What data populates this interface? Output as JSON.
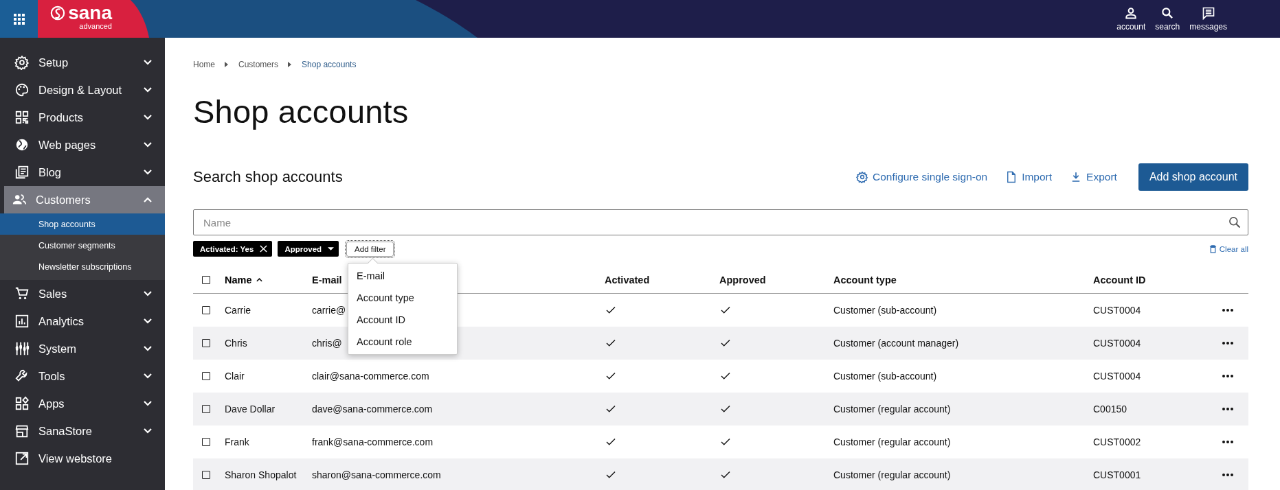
{
  "header": {
    "logo": {
      "name": "sana",
      "edition": "advanced"
    },
    "nav": [
      {
        "label": "account"
      },
      {
        "label": "search"
      },
      {
        "label": "messages"
      }
    ]
  },
  "sidebar": {
    "items": [
      {
        "label": "Setup",
        "kind": "section",
        "expanded": false
      },
      {
        "label": "Design & Layout",
        "kind": "section",
        "expanded": false
      },
      {
        "label": "Products",
        "kind": "section",
        "expanded": false
      },
      {
        "label": "Web pages",
        "kind": "section",
        "expanded": false
      },
      {
        "label": "Blog",
        "kind": "section",
        "expanded": false
      },
      {
        "label": "Customers",
        "kind": "section",
        "expanded": true,
        "children": [
          {
            "label": "Shop accounts",
            "selected": true
          },
          {
            "label": "Customer segments",
            "selected": false
          },
          {
            "label": "Newsletter subscriptions",
            "selected": false
          }
        ]
      },
      {
        "label": "Sales",
        "kind": "section",
        "expanded": false
      },
      {
        "label": "Analytics",
        "kind": "section",
        "expanded": false
      },
      {
        "label": "System",
        "kind": "section",
        "expanded": false
      },
      {
        "label": "Tools",
        "kind": "section",
        "expanded": false
      },
      {
        "label": "Apps",
        "kind": "section",
        "expanded": false
      },
      {
        "label": "SanaStore",
        "kind": "section",
        "expanded": false
      },
      {
        "label": "View webstore",
        "kind": "link"
      }
    ]
  },
  "breadcrumb": [
    "Home",
    "Customers",
    "Shop accounts"
  ],
  "page_title": "Shop accounts",
  "search_section": {
    "title": "Search shop accounts",
    "actions": [
      {
        "label": "Configure single sign-on",
        "kind": "link"
      },
      {
        "label": "Import",
        "kind": "link"
      },
      {
        "label": "Export",
        "kind": "link"
      },
      {
        "label": "Add shop account",
        "kind": "primary"
      }
    ],
    "search": {
      "placeholder": "Name"
    },
    "filters": [
      {
        "label": "Activated: Yes",
        "kind": "removable"
      },
      {
        "label": "Approved",
        "kind": "dropdown"
      }
    ],
    "add_filter": {
      "label": "Add filter",
      "expanded": true,
      "options": [
        "E-mail",
        "Account type",
        "Account ID",
        "Account role"
      ]
    },
    "clear_all": "Clear all"
  },
  "table": {
    "select_all": {
      "checked": false
    },
    "columns": [
      {
        "label": "Name",
        "sorted": true
      },
      {
        "label": "E-mail",
        "sorted": false
      },
      {
        "label": "Activated",
        "sorted": false
      },
      {
        "label": "Approved",
        "sorted": false
      },
      {
        "label": "Account type",
        "sorted": false
      },
      {
        "label": "Account ID",
        "sorted": false
      }
    ],
    "rows": [
      {
        "checked": false,
        "name": "Carrie",
        "email": "carrie@",
        "activated": true,
        "approved": true,
        "account_type": "Customer (sub-account)",
        "account_id": "CUST0004"
      },
      {
        "checked": false,
        "name": "Chris",
        "email": "chris@",
        "activated": true,
        "approved": true,
        "account_type": "Customer (account manager)",
        "account_id": "CUST0004"
      },
      {
        "checked": false,
        "name": "Clair",
        "email": "clair@sana-commerce.com",
        "activated": true,
        "approved": true,
        "account_type": "Customer (sub-account)",
        "account_id": "CUST0004"
      },
      {
        "checked": false,
        "name": "Dave Dollar",
        "email": "dave@sana-commerce.com",
        "activated": true,
        "approved": true,
        "account_type": "Customer (regular account)",
        "account_id": "C00150"
      },
      {
        "checked": false,
        "name": "Frank",
        "email": "frank@sana-commerce.com",
        "activated": true,
        "approved": true,
        "account_type": "Customer (regular account)",
        "account_id": "CUST0002"
      },
      {
        "checked": false,
        "name": "Sharon Shopalot",
        "email": "sharon@sana-commerce.com",
        "activated": true,
        "approved": true,
        "account_type": "Customer (regular account)",
        "account_id": "CUST0001"
      }
    ]
  }
}
